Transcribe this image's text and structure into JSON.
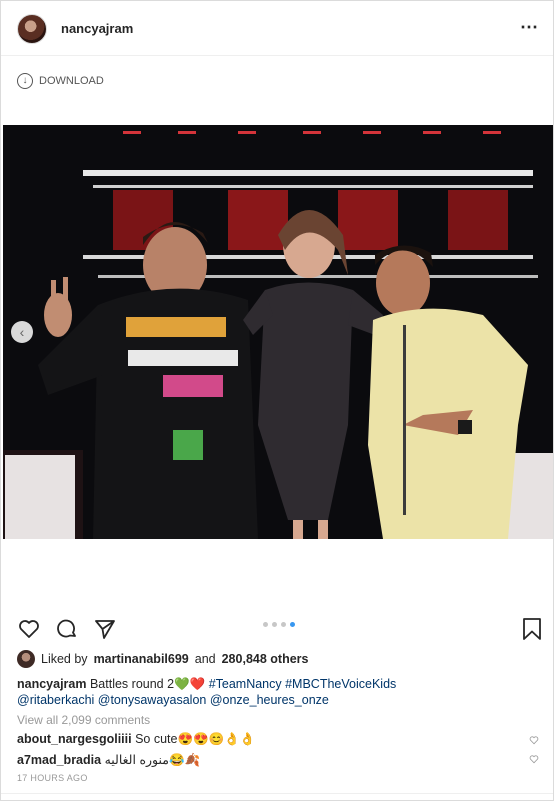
{
  "post": {
    "username": "nancyajram",
    "more_icon": "more-horizontal-icon",
    "download_label": "DOWNLOAD",
    "photo_alt": "",
    "likes": {
      "prefix": "Liked by",
      "liker": "martinanabil699",
      "and": "and",
      "others": "280,848 others"
    },
    "caption": {
      "username": "nancyajram",
      "text": "Battles round 2",
      "emojis": "💚❤️",
      "hashtags": "#TeamNancy #MBCTheVoiceKids",
      "mentions": "@ritaberkachi @tonysawayasalon @onze_heures_onze"
    },
    "view_all": "View all 2,099 comments",
    "comments": [
      {
        "username": "about_nargesgoliiii",
        "text": "So cute😍😍😊👌👌"
      },
      {
        "username": "a7mad_bradia",
        "text": "منوره الغاليه😂🍂"
      }
    ],
    "timestamp": "17 HOURS AGO",
    "carousel": {
      "count": 4,
      "active": 4
    }
  },
  "colors": {
    "link": "#003569",
    "active_dot": "#3897f0",
    "border": "#dbdbdb"
  }
}
